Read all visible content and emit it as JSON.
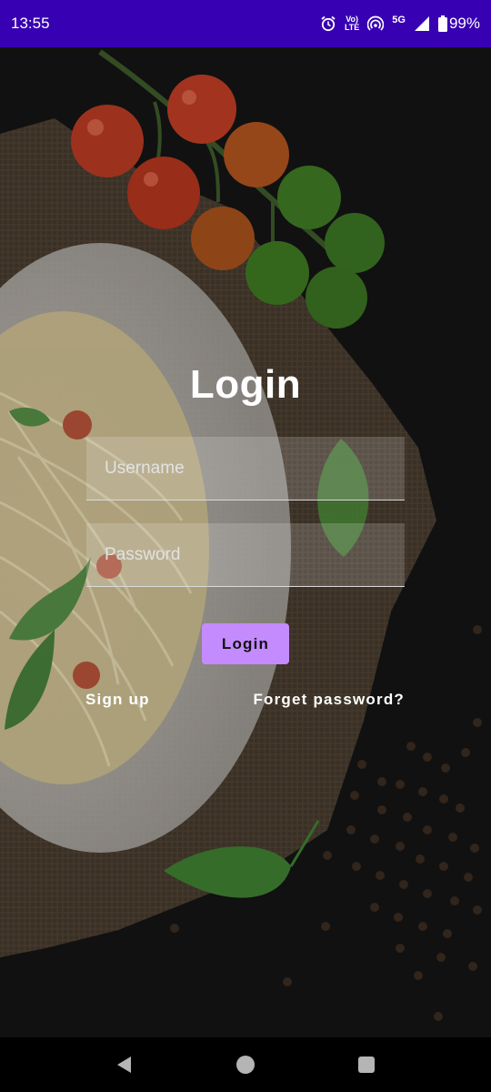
{
  "status": {
    "time": "13:55",
    "network": "5G",
    "volte_top": "Vo)",
    "volte_bottom": "LTE",
    "battery": "99%"
  },
  "login": {
    "title": "Login",
    "username_placeholder": "Username",
    "password_placeholder": "Password",
    "button_label": "Login",
    "signup_label": "Sign up",
    "forget_label": "Forget password?"
  },
  "icons": {
    "status": [
      "alarm-icon",
      "volte-icon",
      "hotspot-icon",
      "signal-icon",
      "battery-icon"
    ],
    "nav": [
      "back-icon",
      "home-icon",
      "recents-icon"
    ]
  },
  "colors": {
    "status_bar": "#3800b3",
    "button": "#c48bff",
    "background": "#141414"
  }
}
